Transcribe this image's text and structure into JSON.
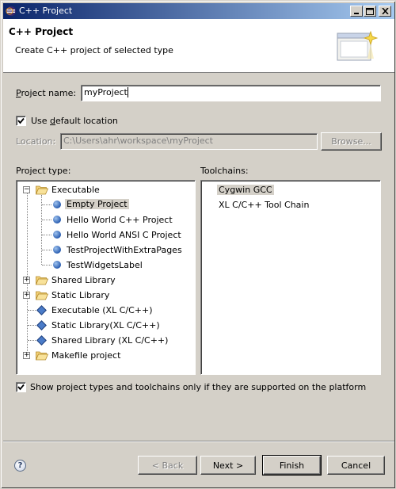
{
  "window": {
    "title": "C++ Project",
    "controls": [
      "minimize",
      "maximize",
      "close"
    ]
  },
  "header": {
    "title": "C++ Project",
    "description": "Create C++ project of selected type",
    "icon": "wizard-banner-icon"
  },
  "form": {
    "project_name_label_pre": "P",
    "project_name_label_post": "roject name:",
    "project_name_value": "myProject",
    "use_default_location_pre": "Use ",
    "use_default_location_u": "d",
    "use_default_location_post": "efault location",
    "use_default_location_checked": true,
    "location_label": "Location:",
    "location_value": "C:\\Users\\ahr\\workspace\\myProject",
    "browse_label": "Browse..."
  },
  "project_type": {
    "label": "Project type:",
    "items": [
      {
        "label": "Executable",
        "kind": "folder",
        "expanded": true,
        "level": 0
      },
      {
        "label": "Empty Project",
        "kind": "leaf",
        "level": 1,
        "selected": true
      },
      {
        "label": "Hello World C++ Project",
        "kind": "leaf",
        "level": 1
      },
      {
        "label": "Hello World ANSI C Project",
        "kind": "leaf",
        "level": 1
      },
      {
        "label": "TestProjectWithExtraPages",
        "kind": "leaf",
        "level": 1
      },
      {
        "label": "TestWidgetsLabel",
        "kind": "leaf",
        "level": 1
      },
      {
        "label": "Shared Library",
        "kind": "folder",
        "expanded": false,
        "level": 0
      },
      {
        "label": "Static Library",
        "kind": "folder",
        "expanded": false,
        "level": 0
      },
      {
        "label": "Executable (XL C/C++)",
        "kind": "diamond",
        "level": 0
      },
      {
        "label": "Static Library(XL C/C++)",
        "kind": "diamond",
        "level": 0
      },
      {
        "label": "Shared Library (XL C/C++)",
        "kind": "diamond",
        "level": 0
      },
      {
        "label": "Makefile project",
        "kind": "folder",
        "expanded": false,
        "level": 0
      }
    ]
  },
  "toolchains": {
    "label": "Toolchains:",
    "items": [
      {
        "label": "Cygwin GCC",
        "selected": true
      },
      {
        "label": "XL C/C++ Tool Chain",
        "selected": false
      }
    ]
  },
  "filter": {
    "checked": true,
    "label": "Show project types and toolchains only if they are supported on the platform"
  },
  "buttons": {
    "back": "< Back",
    "next": "Next >",
    "finish": "Finish",
    "cancel": "Cancel"
  },
  "colors": {
    "title_bar_start": "#0a246a",
    "title_bar_end": "#a6caf0",
    "dialog_bg": "#d4d0c8",
    "selection_bg": "#d4d0c8"
  }
}
